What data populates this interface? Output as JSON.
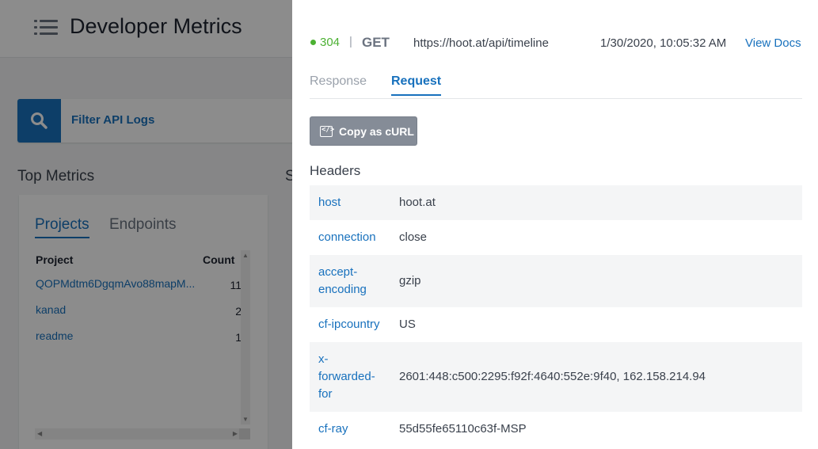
{
  "background": {
    "page_title": "Developer Metrics",
    "filter": {
      "label": "Filter API Logs"
    },
    "top_metrics": {
      "title": "Top Metrics",
      "second_title": "S",
      "tabs": [
        "Projects",
        "Endpoints"
      ],
      "columns": [
        "Project",
        "Count"
      ],
      "rows": [
        {
          "project": "QOPMdtm6DgqmAvo88mapM...",
          "count": "11"
        },
        {
          "project": "kanad",
          "count": "2"
        },
        {
          "project": "readme",
          "count": "1"
        }
      ]
    }
  },
  "panel": {
    "status_code": "304",
    "separator": "|",
    "method": "GET",
    "url": "https://hoot.at/api/timeline",
    "timestamp": "1/30/2020, 10:05:32 AM",
    "view_docs": "View Docs",
    "tabs": {
      "response": "Response",
      "request": "Request"
    },
    "copy_curl": "Copy as cURL",
    "headers_title": "Headers",
    "headers": [
      {
        "key": "host",
        "value": "hoot.at"
      },
      {
        "key": "connection",
        "value": "close"
      },
      {
        "key": "accept-encoding",
        "value": "gzip"
      },
      {
        "key": "cf-ipcountry",
        "value": "US"
      },
      {
        "key": "x-forwarded-for",
        "value": "2601:448:c500:2295:f92f:4640:552e:9f40, 162.158.214.94"
      },
      {
        "key": "cf-ray",
        "value": "55d55fe65110c63f-MSP"
      }
    ]
  },
  "colors": {
    "accent": "#1871bd",
    "status_ok": "#4cb133"
  }
}
